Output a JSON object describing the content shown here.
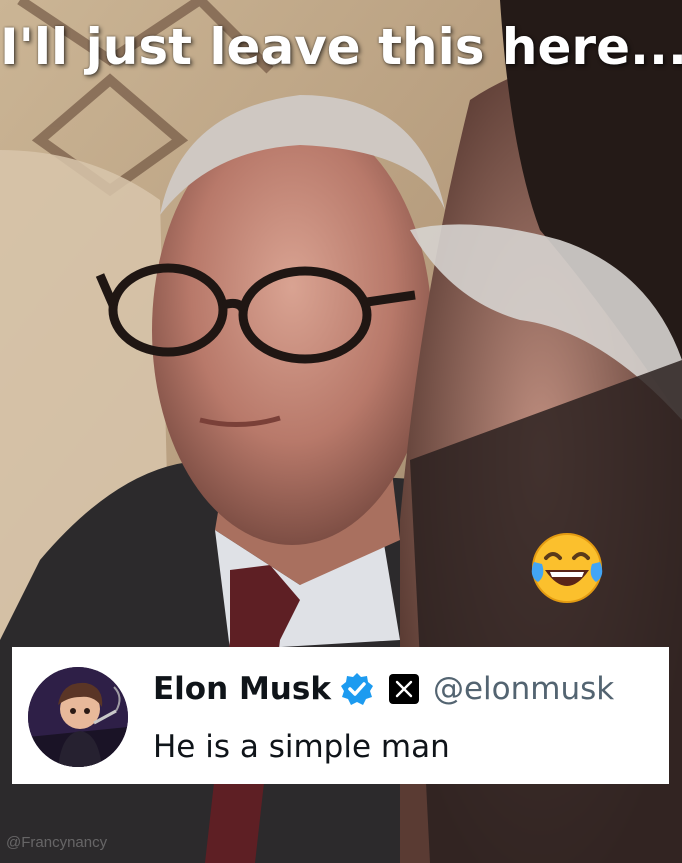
{
  "caption": "I'll just leave this here...",
  "emoji_name": "face-with-tears-of-joy-emoji",
  "tweet": {
    "display_name": "Elon Musk",
    "handle": "@elonmusk",
    "text": "He is a simple man",
    "verified_icon": "verified-badge-icon",
    "platform_icon": "x-logo-icon",
    "avatar": "avatar-cartoon"
  },
  "watermark": "@Francynancy",
  "colors": {
    "caption_text": "#ffffff",
    "tweet_background": "#ffffff",
    "name_text": "#0f1419",
    "handle_text": "#536471",
    "verified_blue": "#1d9bf0"
  }
}
